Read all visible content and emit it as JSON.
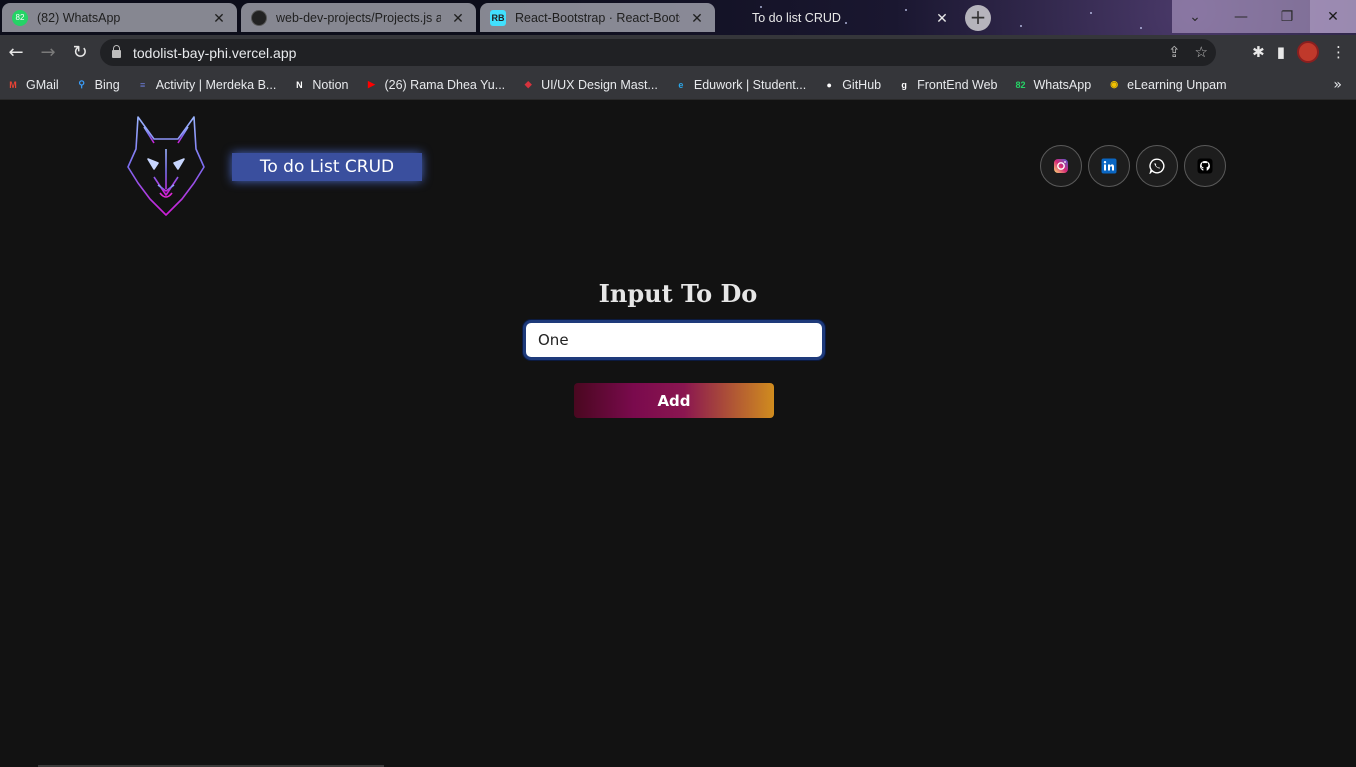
{
  "browser": {
    "tabs": [
      {
        "title": "(82) WhatsApp",
        "favicon": "whatsapp-icon",
        "badge": "82",
        "active": false
      },
      {
        "title": "web-dev-projects/Projects.js at",
        "favicon": "github-icon",
        "active": false
      },
      {
        "title": "React-Bootstrap · React-Bootstra",
        "favicon": "react-bootstrap-icon",
        "favicon_text": "RB",
        "active": false
      },
      {
        "title": "To do list CRUD",
        "favicon": "",
        "active": true
      }
    ],
    "new_tab_label": "+",
    "url": "todolist-bay-phi.vercel.app",
    "bookmarks": [
      {
        "label": "GMail",
        "icon": "gmail-icon",
        "color": "#ea4335",
        "glyph": "M"
      },
      {
        "label": "Bing",
        "icon": "bing-icon",
        "color": "#3aa0ff",
        "glyph": "⚲"
      },
      {
        "label": "Activity | Merdeka B...",
        "icon": "merdeka-icon",
        "color": "#6b7bd6",
        "glyph": "≡"
      },
      {
        "label": "Notion",
        "icon": "notion-icon",
        "color": "#ffffff",
        "glyph": "N"
      },
      {
        "label": "(26) Rama Dhea Yu...",
        "icon": "youtube-icon",
        "color": "#ff0000",
        "glyph": "▶"
      },
      {
        "label": "UI/UX Design Mast...",
        "icon": "uiux-icon",
        "color": "#d6333d",
        "glyph": "◆"
      },
      {
        "label": "Eduwork | Student...",
        "icon": "eduwork-icon",
        "color": "#2aa6e8",
        "glyph": "e"
      },
      {
        "label": "GitHub",
        "icon": "github-icon",
        "color": "#ffffff",
        "glyph": "●"
      },
      {
        "label": "FrontEnd Web",
        "icon": "frontend-icon",
        "color": "#ffffff",
        "glyph": "g"
      },
      {
        "label": "WhatsApp",
        "icon": "whatsapp-icon",
        "color": "#25d366",
        "glyph": "82"
      },
      {
        "label": "eLearning Unpam",
        "icon": "elearning-icon",
        "color": "#f2c200",
        "glyph": "◉"
      }
    ]
  },
  "app": {
    "brand": "To do List CRUD",
    "socials": [
      {
        "name": "instagram-button",
        "icon": "instagram-icon",
        "color": "#e1306c"
      },
      {
        "name": "linkedin-button",
        "icon": "linkedin-icon",
        "color": "#0a66c2"
      },
      {
        "name": "whatsapp-button",
        "icon": "whatsapp-icon",
        "color": "#ffffff"
      },
      {
        "name": "github-button",
        "icon": "github-icon",
        "color": "#000000"
      }
    ],
    "form": {
      "title": "Input To Do",
      "input_value": "One",
      "add_label": "Add"
    }
  }
}
